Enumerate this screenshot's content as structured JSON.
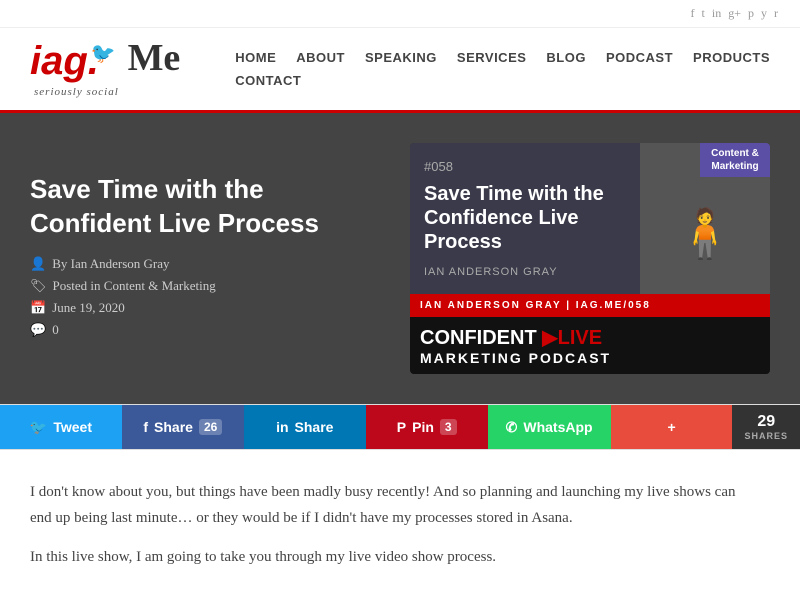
{
  "social_icons": [
    "f",
    "t",
    "in",
    "g+",
    "p",
    "yt",
    "rss"
  ],
  "nav": {
    "items_row1": [
      "HOME",
      "ABOUT",
      "SPEAKING",
      "SERVICES",
      "BLOG",
      "PODCAST",
      "PRODUCTS"
    ],
    "items_row2": [
      "CONTACT"
    ]
  },
  "hero": {
    "title": "Save Time with the Confident Live Process",
    "author": "By Ian Anderson Gray",
    "category": "Posted in Content & Marketing",
    "date": "June 19, 2020",
    "comments": "0"
  },
  "podcast_card": {
    "episode": "#058",
    "title": "Save Time with the Confidence Live Process",
    "author_label": "IAN ANDERSON GRAY",
    "badge_line1": "Content &",
    "badge_line2": "Marketing",
    "footer_text": "IAN ANDERSON GRAY | IAG.ME/058",
    "brand_line1": "CONFIDENT",
    "brand_play": "▶",
    "brand_line1b": "LIVE",
    "brand_line2": "MARKETING PODCAST"
  },
  "share_bar": {
    "twitter_label": "Tweet",
    "facebook_label": "Share",
    "facebook_count": "26",
    "linkedin_label": "Share",
    "pinterest_label": "Pin",
    "pinterest_count": "3",
    "whatsapp_label": "WhatsApp",
    "other_label": "+",
    "total_count": "29",
    "total_label": "SHARES"
  },
  "content": {
    "para1": "I don't know about you, but things have been madly busy recently! And so planning and launching my live shows can end up being last minute… or they would be if I didn't have my processes stored in Asana.",
    "para2": "In this live show, I am going to take you through my live video show process."
  }
}
